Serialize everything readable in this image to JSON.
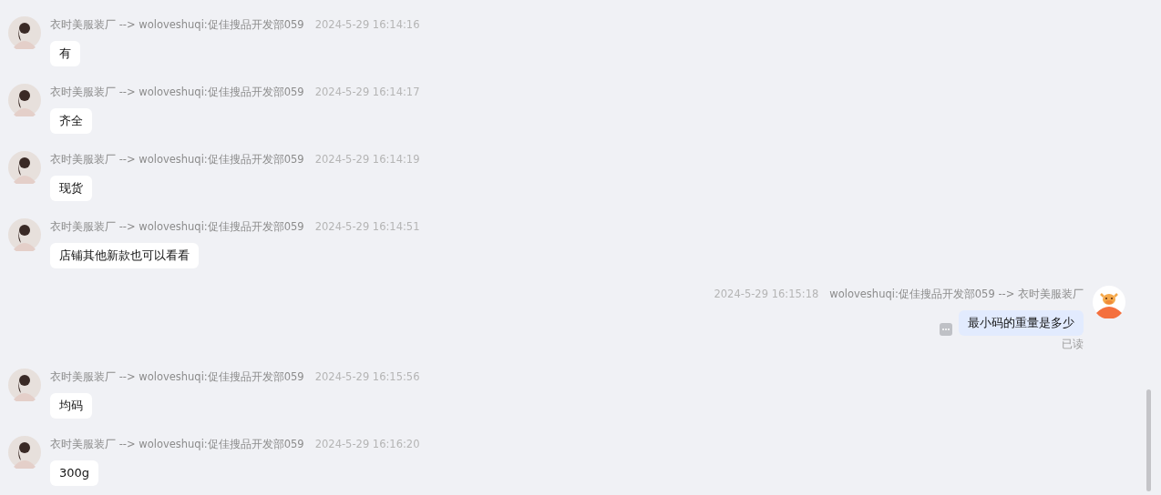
{
  "messages": [
    {
      "kind": "incoming",
      "sender": "衣时美服装厂 --> woloveshuqi:促佳搜品开发部059",
      "time": "2024-5-29 16:14:16",
      "text": "有"
    },
    {
      "kind": "incoming",
      "sender": "衣时美服装厂 --> woloveshuqi:促佳搜品开发部059",
      "time": "2024-5-29 16:14:17",
      "text": "齐全"
    },
    {
      "kind": "incoming",
      "sender": "衣时美服装厂 --> woloveshuqi:促佳搜品开发部059",
      "time": "2024-5-29 16:14:19",
      "text": "现货"
    },
    {
      "kind": "incoming",
      "sender": "衣时美服装厂 --> woloveshuqi:促佳搜品开发部059",
      "time": "2024-5-29 16:14:51",
      "text": "店铺其他新款也可以看看"
    },
    {
      "kind": "outgoing",
      "sender": "woloveshuqi:促佳搜品开发部059 --> 衣时美服装厂",
      "time": "2024-5-29 16:15:18",
      "text": "最小码的重量是多少",
      "status": "已读"
    },
    {
      "kind": "incoming",
      "sender": "衣时美服装厂 --> woloveshuqi:促佳搜品开发部059",
      "time": "2024-5-29 16:15:56",
      "text": "均码"
    },
    {
      "kind": "incoming",
      "sender": "衣时美服装厂 --> woloveshuqi:促佳搜品开发部059",
      "time": "2024-5-29 16:16:20",
      "text": "300g"
    }
  ]
}
